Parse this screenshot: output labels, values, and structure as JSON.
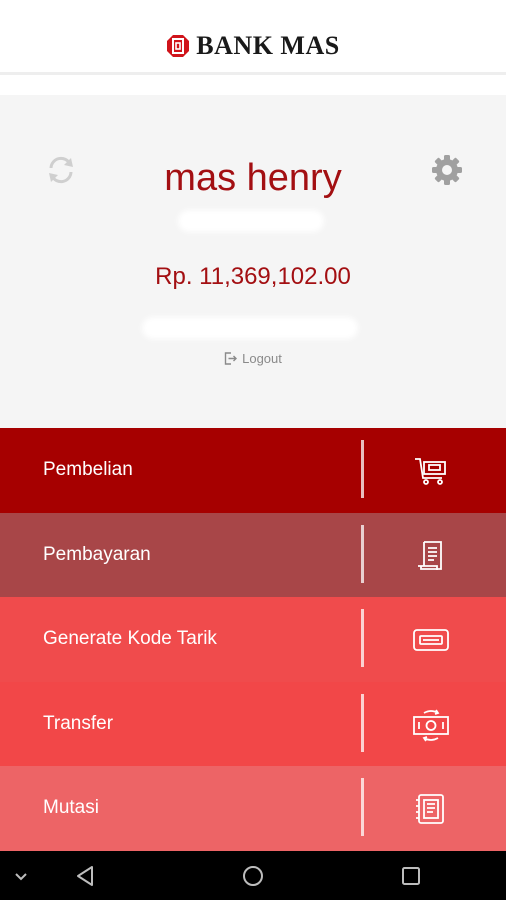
{
  "app": {
    "brand": "BANK MAS"
  },
  "profile": {
    "name": "mas henry",
    "balance": "Rp. 11,369,102.00",
    "logout_label": "Logout"
  },
  "menu": [
    {
      "label": "Pembelian",
      "icon": "cart-icon",
      "color": "#a60000"
    },
    {
      "label": "Pembayaran",
      "icon": "receipt-icon",
      "color": "#a84648"
    },
    {
      "label": "Generate Kode Tarik",
      "icon": "card-icon",
      "color": "#f04b4c"
    },
    {
      "label": "Transfer",
      "icon": "money-transfer-icon",
      "color": "#f24748"
    },
    {
      "label": "Mutasi",
      "icon": "statement-icon",
      "color": "#ed6466"
    }
  ],
  "colors": {
    "accent": "#a30f12",
    "profile_bg": "#f5f5f5"
  }
}
